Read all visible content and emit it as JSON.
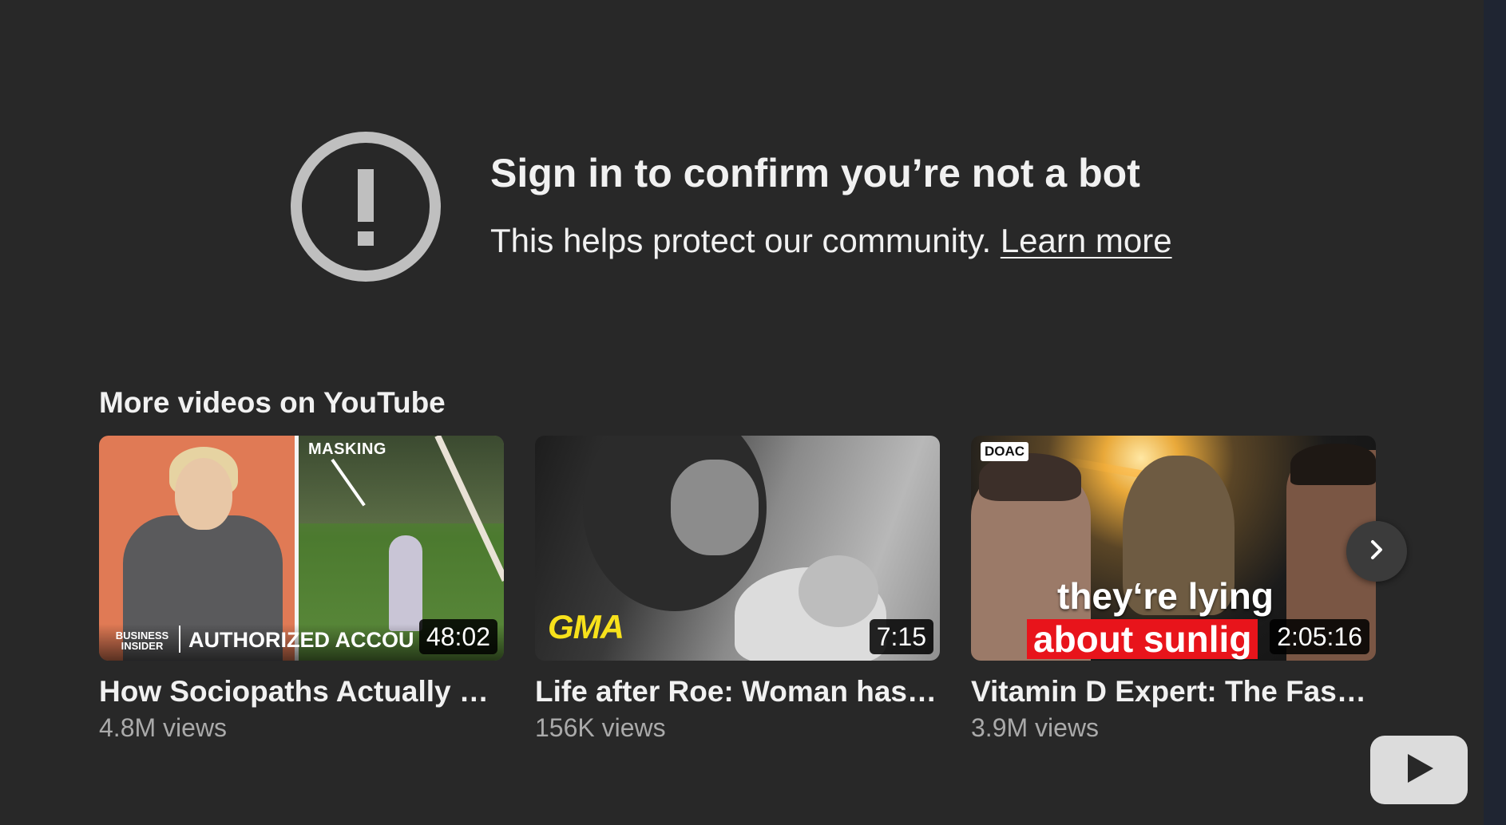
{
  "error": {
    "title": "Sign in to confirm you’re not a bot",
    "subtitle": "This helps protect our community.",
    "link_label": "Learn more"
  },
  "more_videos": {
    "heading": "More videos on YouTube",
    "videos": [
      {
        "title": "How Sociopaths Actually W...",
        "views": "4.8M views",
        "duration": "48:02",
        "thumb_tag": "MASKING",
        "thumb_brand": "BUSINESS INSIDER",
        "thumb_caption": "AUTHORIZED ACCOU"
      },
      {
        "title": "Life after Roe: Woman has ...",
        "views": "156K views",
        "duration": "7:15",
        "thumb_brand": "GMA"
      },
      {
        "title": "Vitamin D Expert: The Faste...",
        "views": "3.9M views",
        "duration": "2:05:16",
        "thumb_brand": "DOAC",
        "thumb_caption_line1": "they‘re lying",
        "thumb_caption_line2": "about sunlig"
      }
    ]
  },
  "icons": {
    "error": "exclamation-circle-icon",
    "next": "chevron-right-icon",
    "logo": "youtube-logo-icon"
  },
  "colors": {
    "background": "#282828",
    "text": "#f1f1f1",
    "secondary_text": "#aaaaaa",
    "icon_gray": "#bfbfbf"
  }
}
